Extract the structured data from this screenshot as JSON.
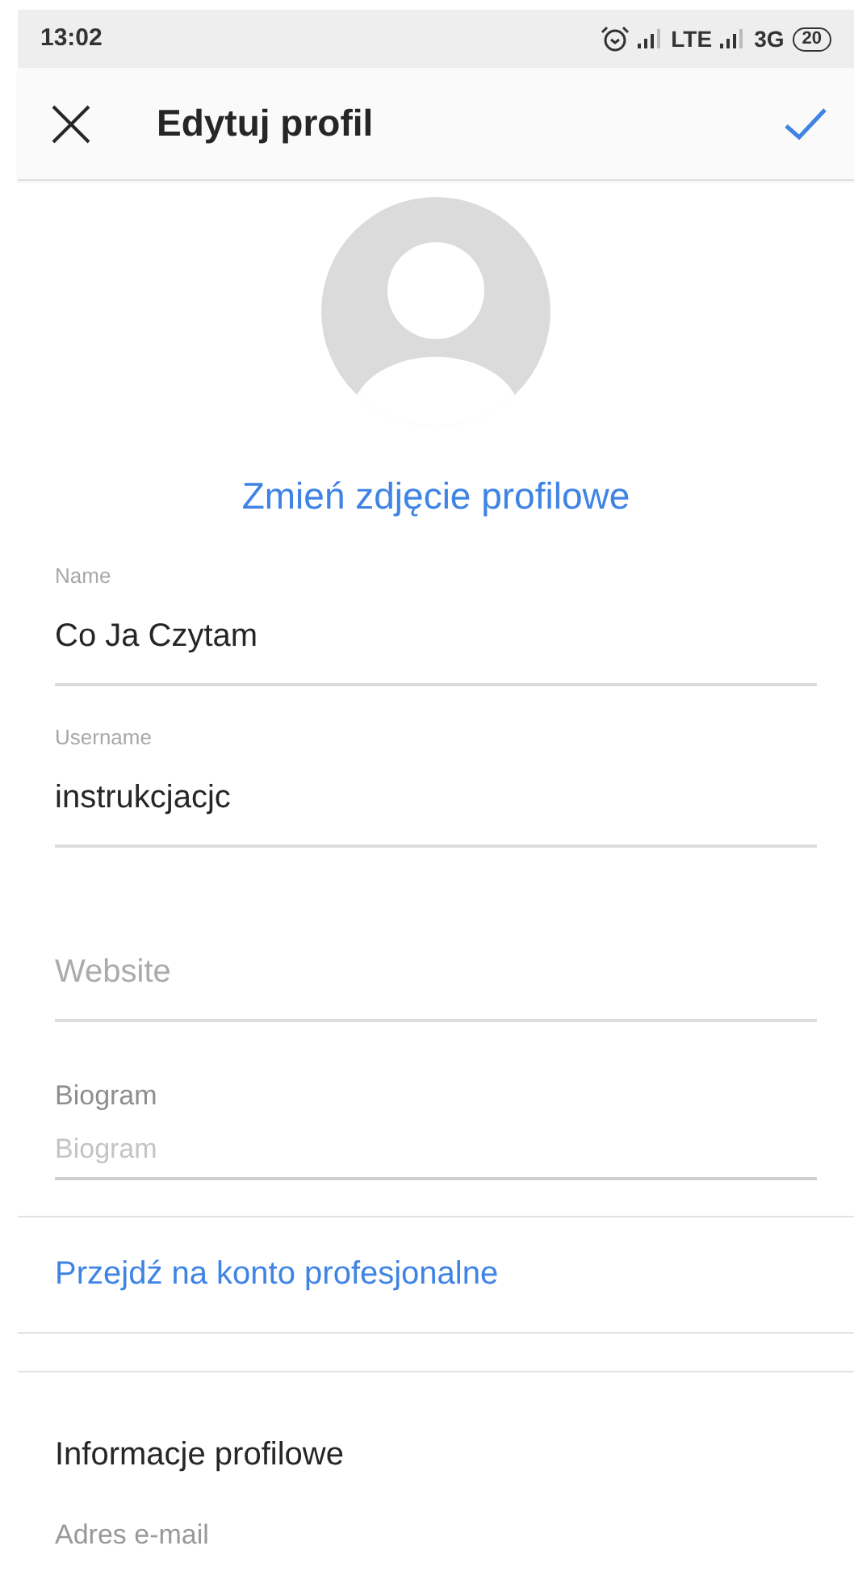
{
  "status_bar": {
    "time": "13:02",
    "network_1": "LTE",
    "network_2": "3G",
    "battery": "20"
  },
  "toolbar": {
    "title": "Edytuj profil"
  },
  "profile_photo": {
    "change_link": "Zmień zdjęcie profilowe"
  },
  "fields": [
    {
      "kind": "text",
      "label": "Name",
      "value": "Co Ja Czytam"
    },
    {
      "kind": "text",
      "label": "Username",
      "value": "instrukcjacjc"
    },
    {
      "kind": "text",
      "placeholder": "Website"
    },
    {
      "kind": "bio",
      "label": "Biogram",
      "placeholder": "Biogram"
    }
  ],
  "professional_link": "Przejdź na konto profesjonalne",
  "section": {
    "title": "Informacje profilowe",
    "first_label": "Adres e-mail"
  }
}
